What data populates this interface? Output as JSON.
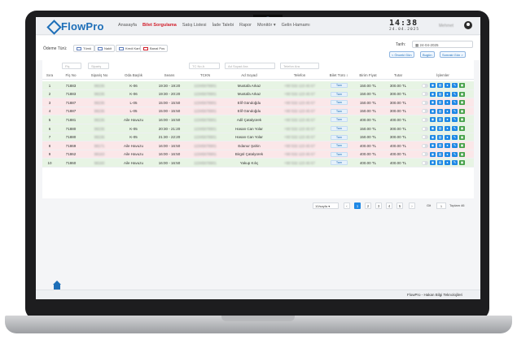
{
  "brand": {
    "name": "FlowPro"
  },
  "nav": [
    {
      "label": "Anasayfa",
      "active": false
    },
    {
      "label": "Bilet Sorgulama",
      "active": true
    },
    {
      "label": "Satış Listesi",
      "active": false
    },
    {
      "label": "İade Talebi",
      "active": false
    },
    {
      "label": "Rapor",
      "active": false
    },
    {
      "label": "Monitör ▾",
      "active": false
    },
    {
      "label": "Gelin Hamamı",
      "active": false
    }
  ],
  "clock": {
    "time": "14:38",
    "date": "24.04.2025"
  },
  "user": {
    "name": "Mehmet"
  },
  "filters": {
    "payment_label": "Ödeme Türü:",
    "payment_types": [
      {
        "label": "Tümü",
        "active": false
      },
      {
        "label": "Nakit",
        "active": false
      },
      {
        "label": "Kredi Kartı",
        "active": false
      },
      {
        "label": "Banal Pos",
        "active": true
      }
    ],
    "date_label": "Tarih:",
    "date_value": "24-04-2025",
    "date_buttons": [
      "< Önceki Gün",
      "Bugün",
      "Sonraki Gün >"
    ]
  },
  "search": {
    "fis": "Fiş",
    "siparis": "Sipariş",
    "tc": "TC No A",
    "ad": "Ad Soyad Ara",
    "telefon": "Telefon Ara"
  },
  "table": {
    "headers": [
      "Sıra",
      "Fiş No",
      "Sipariş No",
      "Oda Başlık",
      "Seans",
      "TCKN",
      "Ad Soyad",
      "Telefon",
      "Bilet Türü ↕",
      "Birim Fiyat",
      "Tutar",
      "İşlemler"
    ],
    "rows": [
      {
        "sira": "1",
        "fis": "71883",
        "siparis": "98236",
        "oda": "K-06",
        "seans": "19:30 - 19:20",
        "tckn": "12345678901",
        "ad": "Mustafa Arkaz",
        "tel": "+90 532 123 45 67",
        "bilet": "Tam",
        "birim": "150.00 TL",
        "tutar": "300.00 TL",
        "color": "g"
      },
      {
        "sira": "2",
        "fis": "71883",
        "siparis": "98236",
        "oda": "K-06",
        "seans": "19:30 - 20:20",
        "tckn": "12345678901",
        "ad": "Mustafa Arkaz",
        "tel": "+90 532 123 45 67",
        "bilet": "Tam",
        "birim": "150.00 TL",
        "tutar": "300.00 TL",
        "color": "g"
      },
      {
        "sira": "3",
        "fis": "71887",
        "siparis": "98236",
        "oda": "L-05",
        "seans": "15:00 - 15:50",
        "tckn": "12345678901",
        "ad": "Elif Gündoğdu",
        "tel": "+90 532 123 45 67",
        "bilet": "Tam",
        "birim": "150.00 TL",
        "tutar": "300.00 TL",
        "color": "r"
      },
      {
        "sira": "4",
        "fis": "71887",
        "siparis": "98236",
        "oda": "L-05",
        "seans": "15:00 - 15:50",
        "tckn": "12345678901",
        "ad": "Elif Gündoğdu",
        "tel": "+90 532 123 45 67",
        "bilet": "Tam",
        "birim": "150.00 TL",
        "tutar": "300.00 TL",
        "color": "r"
      },
      {
        "sira": "5",
        "fis": "71881",
        "siparis": "98236",
        "oda": "Aile Havuzu",
        "seans": "16:00 - 16:50",
        "tckn": "12345678901",
        "ad": "Adil Çatalyürek",
        "tel": "+90 532 123 45 67",
        "bilet": "Tam",
        "birim": "400.00 TL",
        "tutar": "400.00 TL",
        "color": "g"
      },
      {
        "sira": "6",
        "fis": "71880",
        "siparis": "98236",
        "oda": "K-05",
        "seans": "20:30 - 21:20",
        "tckn": "12345678901",
        "ad": "Hasan Can Yolar",
        "tel": "+90 532 123 45 67",
        "bilet": "Tam",
        "birim": "150.00 TL",
        "tutar": "300.00 TL",
        "color": "g"
      },
      {
        "sira": "7",
        "fis": "71880",
        "siparis": "98236",
        "oda": "K-05",
        "seans": "21:30 - 22:20",
        "tckn": "12345678901",
        "ad": "Hasan Can Yolar",
        "tel": "+90 532 123 45 67",
        "bilet": "Tam",
        "birim": "150.00 TL",
        "tutar": "300.00 TL",
        "color": "g"
      },
      {
        "sira": "8",
        "fis": "71869",
        "siparis": "98171",
        "oda": "Aile Havuzu",
        "seans": "16:00 - 16:50",
        "tckn": "12345678901",
        "ad": "Edanur Şahin",
        "tel": "+90 532 123 45 67",
        "bilet": "Tam",
        "birim": "400.00 TL",
        "tutar": "400.00 TL",
        "color": "r"
      },
      {
        "sira": "9",
        "fis": "71862",
        "siparis": "98163",
        "oda": "Aile Havuzu",
        "seans": "16:00 - 16:50",
        "tckn": "12345678901",
        "ad": "Birgül Çatalyürek",
        "tel": "+90 532 123 45 67",
        "bilet": "Tam",
        "birim": "400.00 TL",
        "tutar": "400.00 TL",
        "color": "r"
      },
      {
        "sira": "10",
        "fis": "71860",
        "siparis": "98160",
        "oda": "Aile Havuzu",
        "seans": "16:00 - 16:50",
        "tckn": "12345678901",
        "ad": "Yakup Kılıç",
        "tel": "+90 532 123 45 67",
        "bilet": "Tam",
        "birim": "400.00 TL",
        "tutar": "400.00 TL",
        "color": "g"
      }
    ]
  },
  "pagination": {
    "per_page": "10/sayfa",
    "pages": [
      "1",
      "2",
      "3",
      "4",
      "5"
    ],
    "current": "1",
    "goto_label": "Git",
    "goto_value": "1",
    "total": "Toplam 46"
  },
  "footer": {
    "text": "FlowPro - Hakan Bilgi Teknolojileri"
  }
}
